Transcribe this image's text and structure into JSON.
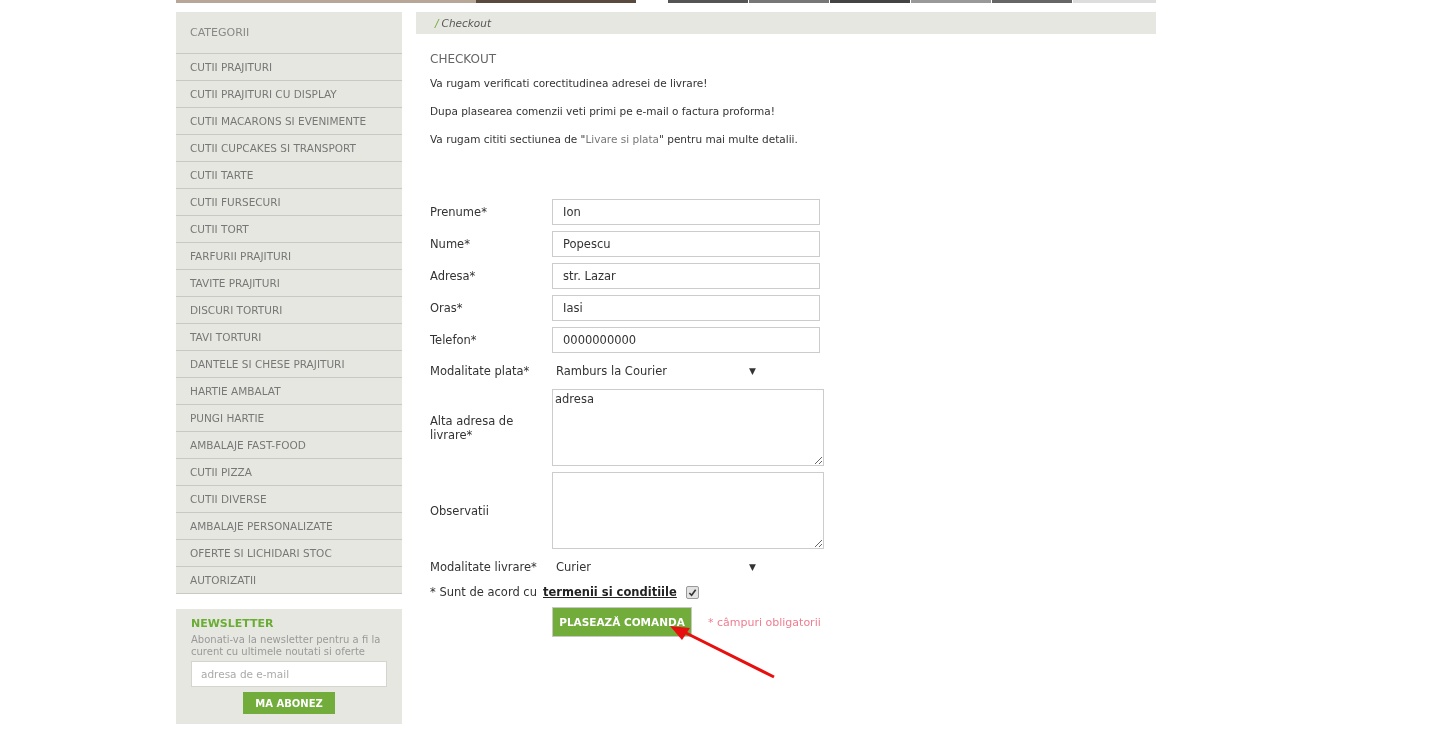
{
  "sidebar": {
    "title": "CATEGORII",
    "items": [
      {
        "label": "CUTII PRAJITURI"
      },
      {
        "label": "CUTII PRAJITURI CU DISPLAY"
      },
      {
        "label": "CUTII MACARONS SI EVENIMENTE"
      },
      {
        "label": "CUTII CUPCAKES SI TRANSPORT"
      },
      {
        "label": "CUTII TARTE"
      },
      {
        "label": "CUTII FURSECURI"
      },
      {
        "label": "CUTII TORT"
      },
      {
        "label": "FARFURII PRAJITURI"
      },
      {
        "label": "TAVITE PRAJITURI"
      },
      {
        "label": "DISCURI TORTURI"
      },
      {
        "label": "TAVI TORTURI"
      },
      {
        "label": "DANTELE SI CHESE PRAJITURI"
      },
      {
        "label": "HARTIE AMBALAT"
      },
      {
        "label": "PUNGI HARTIE"
      },
      {
        "label": "AMBALAJE FAST-FOOD"
      },
      {
        "label": "CUTII PIZZA"
      },
      {
        "label": "CUTII DIVERSE"
      },
      {
        "label": "AMBALAJE PERSONALIZATE"
      },
      {
        "label": "OFERTE SI LICHIDARI STOC"
      },
      {
        "label": "AUTORIZATII"
      }
    ]
  },
  "newsletter": {
    "title": "NEWSLETTER",
    "text": "Abonati-va la newsletter pentru a fi la curent cu ultimele noutati si oferte",
    "placeholder": "adresa de e-mail",
    "button": "MA ABONEZ"
  },
  "breadcrumb": {
    "separator": "/",
    "current": "Checkout"
  },
  "checkout": {
    "title": "CHECKOUT",
    "notes": [
      {
        "before": "Va rugam verificati corectitudinea adresei de livrare!"
      },
      {
        "before": "Dupa plasearea comenzii veti primi pe e-mail o factura proforma!"
      },
      {
        "before": "Va rugam cititi sectiunea de \"",
        "link": "Livare si plata",
        "after": "\" pentru mai multe detalii."
      }
    ],
    "fields": [
      {
        "kind": "input",
        "label": "Prenume*",
        "value": "Ion"
      },
      {
        "kind": "input",
        "label": "Nume*",
        "value": "Popescu"
      },
      {
        "kind": "input",
        "label": "Adresa*",
        "value": "str. Lazar"
      },
      {
        "kind": "input",
        "label": "Oras*",
        "value": "Iasi"
      },
      {
        "kind": "input",
        "label": "Telefon*",
        "value": "0000000000"
      },
      {
        "kind": "select",
        "label": "Modalitate plata*",
        "value": "Ramburs la Courier",
        "caret": "▼"
      },
      {
        "kind": "textarea",
        "label": "Alta adresa de livrare*",
        "value": "adresa"
      },
      {
        "kind": "textarea",
        "label": "Observatii"
      },
      {
        "kind": "select",
        "label": "Modalitate livrare*",
        "value": "Curier",
        "caret": "▼"
      }
    ],
    "terms": {
      "text": "* Sunt de acord cu",
      "link": "termenii si conditiile",
      "checked": true
    },
    "submit": "PLASEAZĂ COMANDA",
    "required_note": "* câmpuri obligatorii"
  }
}
